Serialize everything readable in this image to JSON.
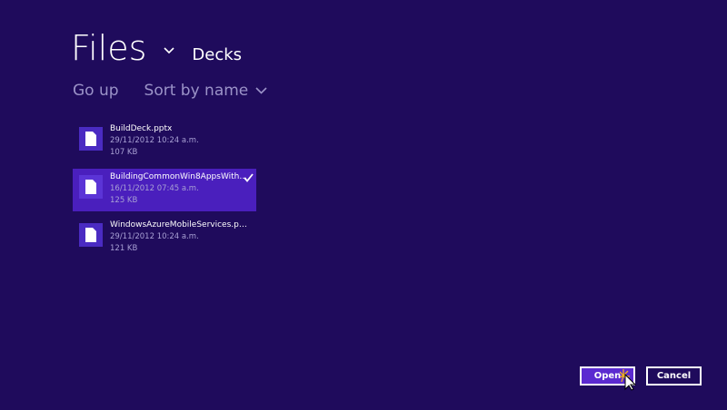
{
  "header": {
    "title": "Files",
    "location": "Decks"
  },
  "toolbar": {
    "go_up": "Go up",
    "sort": "Sort by name"
  },
  "files": [
    {
      "name": "BuildDeck.pptx",
      "date": "29/11/2012 10:24 a.m.",
      "size": "107 KB",
      "selected": false
    },
    {
      "name": "BuildingCommonWin8AppsWith…",
      "date": "16/11/2012 07:45 a.m.",
      "size": "125 KB",
      "selected": true
    },
    {
      "name": "WindowsAzureMobileServices.p…",
      "date": "29/11/2012 10:24 a.m.",
      "size": "121 KB",
      "selected": false
    }
  ],
  "buttons": {
    "open": "Open",
    "cancel": "Cancel"
  },
  "colors": {
    "background": "#1f0b5c",
    "selection": "#4a1fbd",
    "accent": "#5b2ad0"
  }
}
